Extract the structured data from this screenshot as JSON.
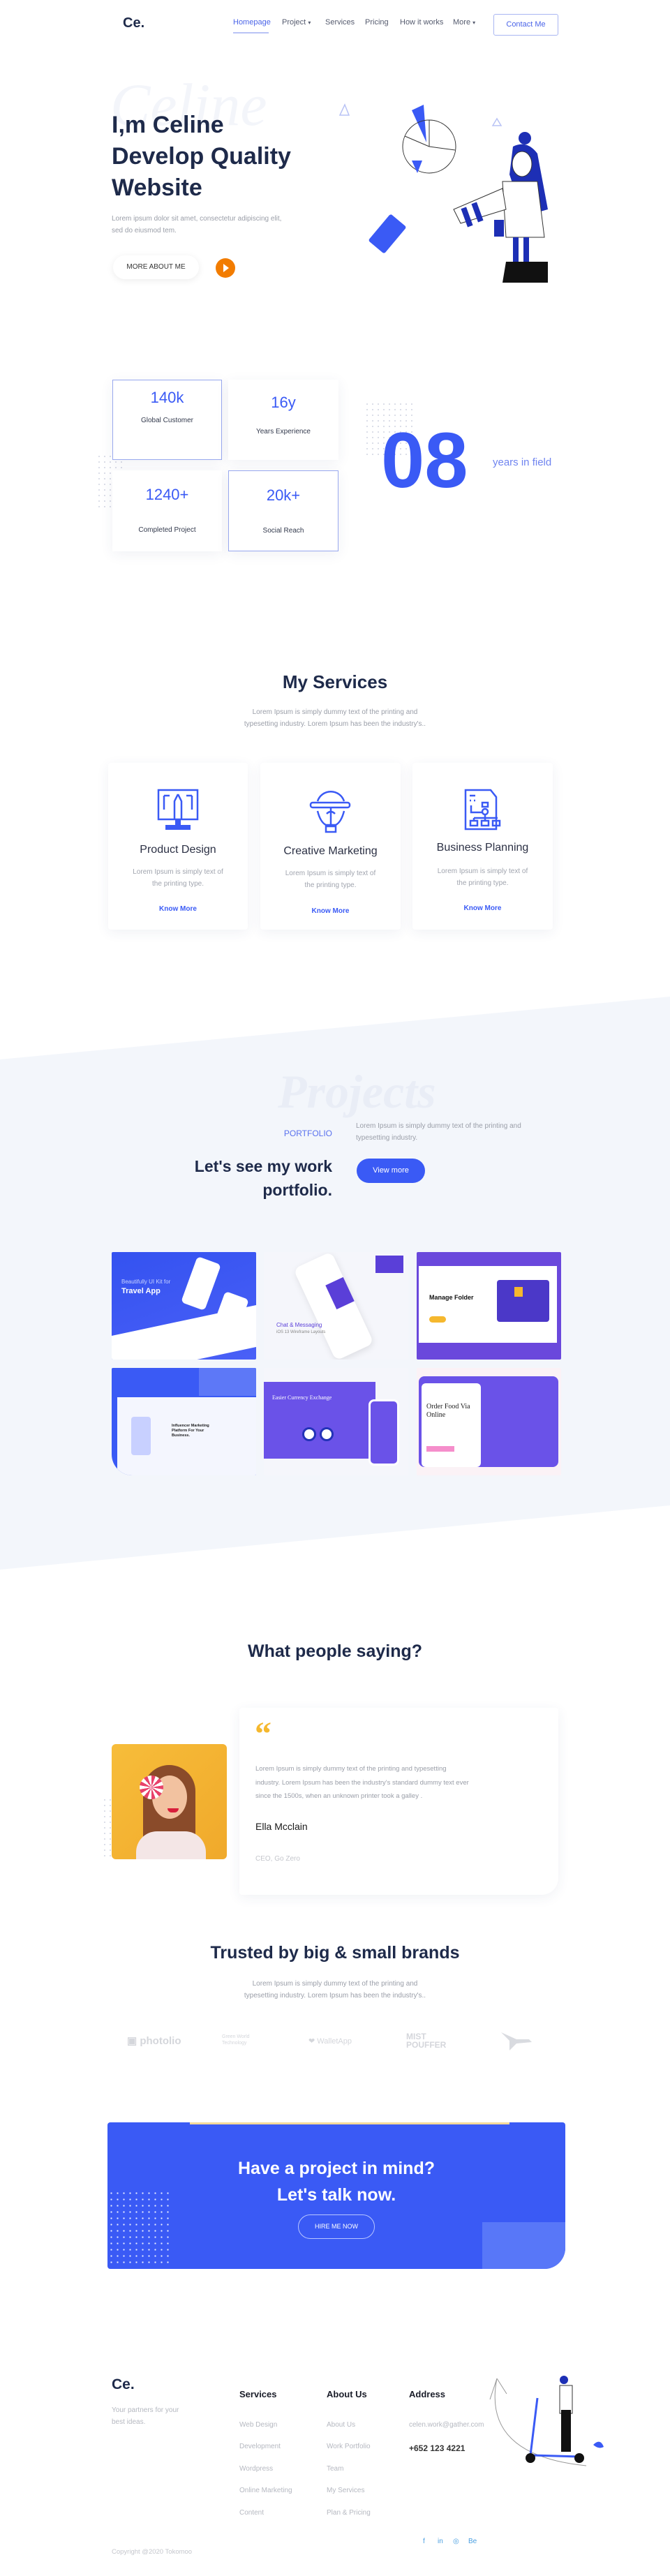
{
  "colors": {
    "accent": "#3a5af5",
    "heading": "#1e2a4a",
    "quote": "#f5b82e",
    "play": "#f27c00",
    "band": "#f3f6fb"
  },
  "nav": {
    "logo": "Ce.",
    "items": [
      {
        "label": "Homepage",
        "active": true
      },
      {
        "label": "Project",
        "dropdown": true
      },
      {
        "label": "Services"
      },
      {
        "label": "Pricing"
      },
      {
        "label": "How it works"
      },
      {
        "label": "More",
        "dropdown": true
      }
    ],
    "contact": "Contact Me"
  },
  "hero": {
    "watermark": "Celine",
    "title_lines": [
      "I,m Celine",
      "Develop Quality",
      "Website"
    ],
    "text_lines": [
      "Lorem ipsum dolor sit amet, consectetur adipiscing elit,",
      "sed do eiusmod tem."
    ],
    "button": "MORE ABOUT ME",
    "play_icon": "play-icon"
  },
  "stats": {
    "items": [
      {
        "value": "140k",
        "label": "Global Customer"
      },
      {
        "value": "16y",
        "label": "Years Experience"
      },
      {
        "value": "1240+",
        "label": "Completed Project"
      },
      {
        "value": "20k+",
        "label": "Social Reach"
      }
    ],
    "big_number": "08",
    "big_label": "years in field"
  },
  "services": {
    "title": "My Services",
    "subtitle_lines": [
      "Lorem Ipsum is simply dummy text of the printing and",
      "typesetting industry. Lorem Ipsum has been the industry's.."
    ],
    "items": [
      {
        "icon": "monitor-pen-icon",
        "title": "Product Design",
        "text_lines": [
          "Lorem Ipsum is simply text of",
          "the printing type."
        ],
        "link": "Know More"
      },
      {
        "icon": "lightbulb-icon",
        "title": "Creative Marketing",
        "text_lines": [
          "Lorem Ipsum is simply text of",
          "the printing type."
        ],
        "link": "Know More"
      },
      {
        "icon": "flowchart-document-icon",
        "title": "Business Planning",
        "text_lines": [
          "Lorem Ipsum is simply text of",
          "the printing type."
        ],
        "link": "Know More"
      }
    ]
  },
  "portfolio": {
    "watermark": "Projects",
    "eyebrow": "PORTFOLIO",
    "title_lines": [
      "Let's see my work",
      "portfolio."
    ],
    "text_lines": [
      "Lorem Ipsum is simply dummy text of the printing and",
      "typesetting industry."
    ],
    "button": "View more",
    "items": [
      {
        "title": "Travel App",
        "subtitle": "Beautifully UI Kit for"
      },
      {
        "title": "Chat & Messaging",
        "subtitle": "iOS 13 Wireframe Layouts"
      },
      {
        "title": "Manage Folder"
      },
      {
        "title": "Influencer Marketing Platform For Your Business."
      },
      {
        "title": "Easier Currency Exchange"
      },
      {
        "title": "Order Food Via Online"
      }
    ]
  },
  "testimonial": {
    "title": "What people saying?",
    "quote_mark": "“",
    "text_lines": [
      "Lorem Ipsum is simply dummy text of the printing and typesetting",
      "industry. Lorem Ipsum has been the industry's standard dummy text ever",
      "since the 1500s, when an unknown printer took a galley ."
    ],
    "name": "Ella Mcclain",
    "role": "CEO, Go Zero"
  },
  "brands": {
    "title": "Trusted by big & small brands",
    "subtitle_lines": [
      "Lorem Ipsum is simply dummy text of the printing and",
      "typesetting industry. Lorem Ipsum has been the industry's.."
    ],
    "logos": [
      "photolio",
      "Green World Technology",
      "WalletApp",
      "MIST POUFFER",
      "bird-logo"
    ]
  },
  "cta": {
    "title_lines": [
      "Have a project in mind?",
      "Let's talk now."
    ],
    "button": "HIRE ME NOW"
  },
  "footer": {
    "logo": "Ce.",
    "tagline_lines": [
      "Your partners for your",
      "best ideas."
    ],
    "columns": [
      {
        "title": "Services",
        "links": [
          "Web Design",
          "Development",
          "Wordpress",
          "Online Marketing",
          "Content"
        ]
      },
      {
        "title": "About Us",
        "links": [
          "About Us",
          "Work Portfolio",
          "Team",
          "My Services",
          "Plan & Pricing"
        ]
      }
    ],
    "address": {
      "title": "Address",
      "email": "celen.work@gather.com",
      "phone": "+652 123 4221"
    },
    "social": [
      "facebook-icon",
      "linkedin-icon",
      "dribbble-icon",
      "behance-icon"
    ],
    "social_labels": [
      "f",
      "in",
      "◎",
      "Be"
    ],
    "copyright": "Copyright @2020 Tokomoo"
  }
}
